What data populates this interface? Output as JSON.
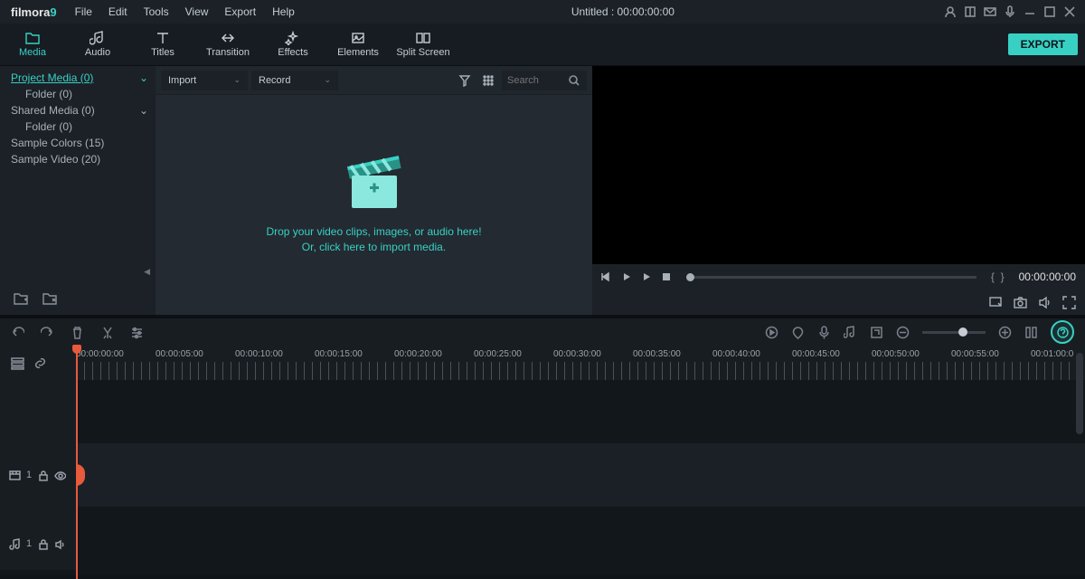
{
  "app": {
    "name": "filmora",
    "version": "9"
  },
  "menubar": [
    "File",
    "Edit",
    "Tools",
    "View",
    "Export",
    "Help"
  ],
  "title": "Untitled : 00:00:00:00",
  "tabs": [
    {
      "label": "Media",
      "active": true
    },
    {
      "label": "Audio"
    },
    {
      "label": "Titles"
    },
    {
      "label": "Transition"
    },
    {
      "label": "Effects"
    },
    {
      "label": "Elements"
    },
    {
      "label": "Split Screen"
    }
  ],
  "export_label": "EXPORT",
  "sidebar": {
    "items": [
      {
        "label": "Project Media (0)",
        "active": true,
        "expandable": true
      },
      {
        "label": "Folder (0)",
        "sub": true
      },
      {
        "label": "Shared Media (0)",
        "expandable": true
      },
      {
        "label": "Folder (0)",
        "sub": true
      },
      {
        "label": "Sample Colors (15)"
      },
      {
        "label": "Sample Video (20)"
      }
    ]
  },
  "media_toolbar": {
    "import_label": "Import",
    "record_label": "Record",
    "search_placeholder": "Search"
  },
  "drop_zone": {
    "line1": "Drop your video clips, images, or audio here!",
    "line2": "Or, click here to import media."
  },
  "preview": {
    "time": "00:00:00:00"
  },
  "ruler_ticks": [
    "00:00:00:00",
    "00:00:05:00",
    "00:00:10:00",
    "00:00:15:00",
    "00:00:20:00",
    "00:00:25:00",
    "00:00:30:00",
    "00:00:35:00",
    "00:00:40:00",
    "00:00:45:00",
    "00:00:50:00",
    "00:00:55:00",
    "00:01:00:0"
  ],
  "tracks": {
    "video": {
      "num": "1"
    },
    "audio": {
      "num": "1"
    }
  }
}
